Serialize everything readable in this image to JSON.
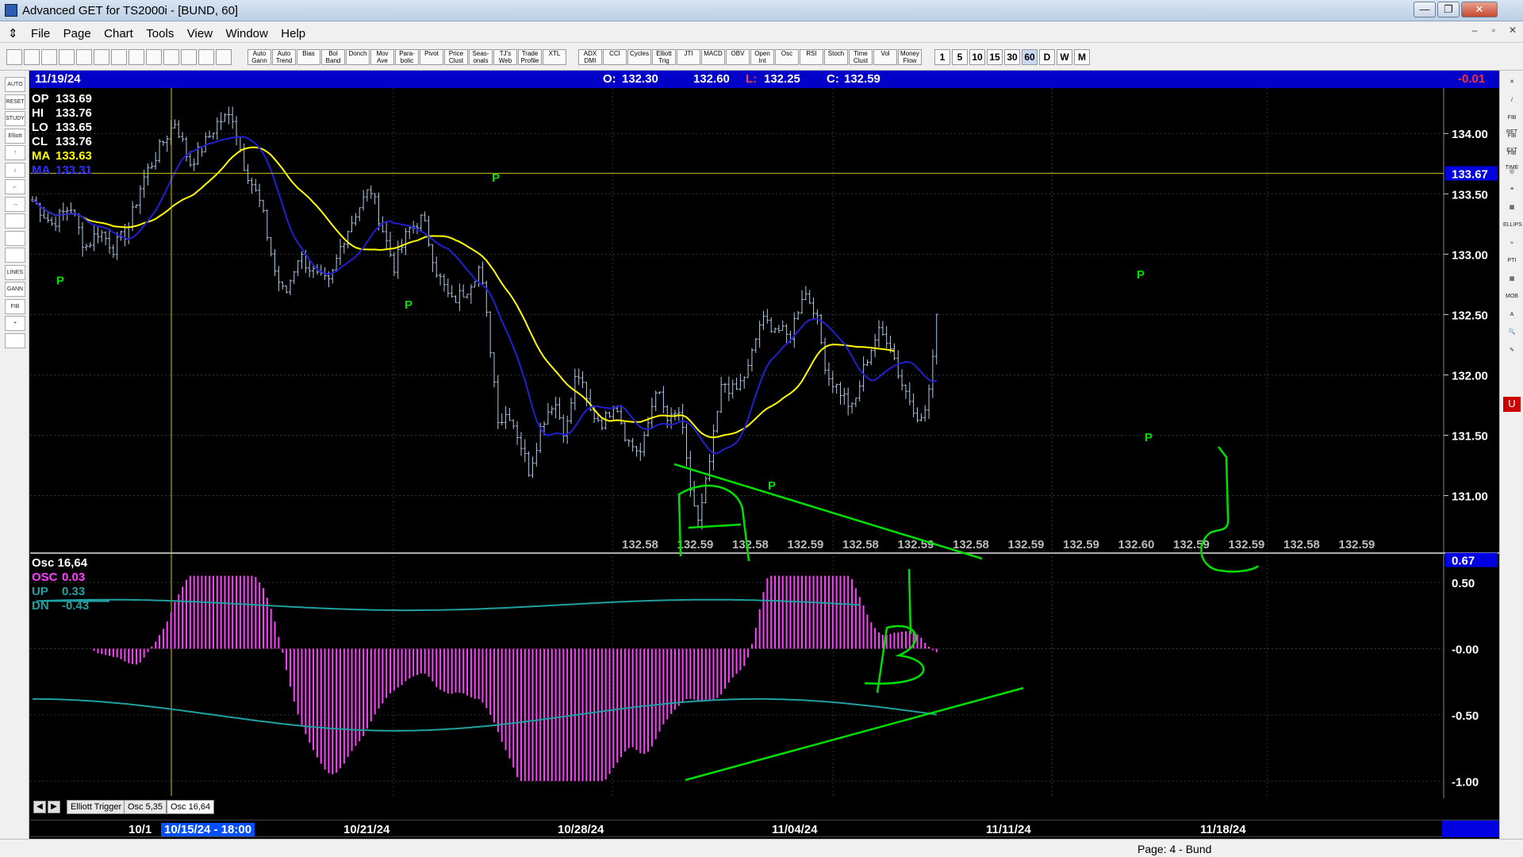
{
  "window": {
    "title": "Advanced GET for TS2000i - [BUND, 60]",
    "buttons": [
      "—",
      "❐",
      "✕"
    ]
  },
  "menu": {
    "items": [
      "File",
      "Page",
      "Chart",
      "Tools",
      "View",
      "Window",
      "Help"
    ],
    "mdi_buttons": [
      "–",
      "▫",
      "✕"
    ]
  },
  "toolbar": {
    "study_buttons": [
      "Auto Gann",
      "Auto Trend",
      "Bias",
      "Bol Band",
      "Donch",
      "Mov Ave",
      "Para-bolic",
      "Pivot",
      "Price Clust",
      "Seas-onals",
      "TJ's Web",
      "Trade Profile",
      "XTL",
      "ADX DMI",
      "CCI",
      "Cycles",
      "Elliott Trig",
      "JTI",
      "MACD",
      "OBV",
      "Open Int",
      "Osc",
      "RSI",
      "Stoch",
      "Time Clust",
      "Vol",
      "Money Flow"
    ],
    "timeframes": [
      "1",
      "5",
      "10",
      "15",
      "30",
      "60",
      "D",
      "W",
      "M"
    ],
    "active_timeframe": "60"
  },
  "left_tools": [
    "AUTO",
    "RESET",
    "STUDY",
    "Elliott",
    "↑",
    "↓",
    "←",
    "→",
    "",
    "",
    "",
    "LINES",
    "GANN",
    "FIB",
    "+",
    ""
  ],
  "right_tools": [
    "✕",
    "/",
    "FIB RET",
    "FIB EXT",
    "FIB TIME",
    "◎",
    "≡",
    "▦",
    "ELLIPS",
    "≈",
    "PTI",
    "▦",
    "MOB",
    "A",
    "🔍",
    "✎",
    "",
    "",
    "U"
  ],
  "header": {
    "date": "11/19/24",
    "open_label": "O:",
    "open": "132.30",
    "high": "132.60",
    "low_label": "L:",
    "low": "132.25",
    "close_label": "C:",
    "close": "132.59",
    "change": "-0.01"
  },
  "price_panel": {
    "stats": [
      {
        "label": "OP",
        "value": "133.69",
        "color": "#ffffff"
      },
      {
        "label": "HI",
        "value": "133.76",
        "color": "#ffffff"
      },
      {
        "label": "LO",
        "value": "133.65",
        "color": "#ffffff"
      },
      {
        "label": "CL",
        "value": "133.76",
        "color": "#ffffff"
      },
      {
        "label": "MA",
        "value": "133.63",
        "color": "#ffff00"
      },
      {
        "label": "MA",
        "value": "133.31",
        "color": "#3030ff"
      }
    ],
    "y_ticks": [
      "134.00",
      "133.50",
      "133.00",
      "132.50",
      "132.00",
      "131.50",
      "131.00"
    ],
    "y_range": [
      130.55,
      134.35
    ],
    "cursor_price": "133.67",
    "bottom_values": [
      "132.58",
      "132.59",
      "132.58",
      "132.59",
      "132.58",
      "132.59",
      "132.58",
      "132.59",
      "132.59",
      "132.60",
      "132.59",
      "132.59",
      "132.58",
      "132.59"
    ],
    "pivot_label": "P",
    "handwritten_labels": [
      "A",
      "B",
      "C"
    ]
  },
  "osc_panel": {
    "stats": [
      {
        "label": "Osc 16,64",
        "value": "",
        "color": "#ffffff"
      },
      {
        "label": "OSC",
        "value": "0.03",
        "color": "#ff40ff"
      },
      {
        "label": "UP",
        "value": "0.33",
        "color": "#20a0a0"
      },
      {
        "label": "DN",
        "value": "-0.43",
        "color": "#20a0a0"
      }
    ],
    "y_ticks": [
      "0.50",
      "-0.00",
      "-0.50",
      "-1.00"
    ],
    "y_range": [
      -1.1,
      0.65
    ],
    "cursor_value": "0.67"
  },
  "chart_data": {
    "type": "candlestick",
    "symbol": "BUND",
    "interval": "60",
    "ylim": [
      130.55,
      134.35
    ],
    "series": [
      {
        "name": "MA",
        "color": "#ffff00",
        "value": 133.63
      },
      {
        "name": "MA",
        "color": "#3030ff",
        "value": 133.31
      }
    ],
    "pivot_lows": [
      132.78,
      132.57,
      131.12,
      131.75,
      131.52
    ],
    "pivot_highs": [
      133.55,
      132.78
    ],
    "oscillator": {
      "name": "Osc 16,64",
      "osc": 0.03,
      "up": 0.33,
      "dn": -0.43,
      "ylim": [
        -1.1,
        0.65
      ]
    },
    "x_dates": [
      "10/1",
      "10/15/24 - 18:00",
      "10/21/24",
      "10/28/24",
      "11/04/24",
      "11/11/24",
      "11/18/24"
    ]
  },
  "tabs": [
    "Elliott Trigger",
    "Osc 5,35",
    "Osc 16,64"
  ],
  "active_tab": "Osc 16,64",
  "dates": {
    "first": "10/1",
    "cursor": "10/15/24 - 18:00",
    "labels": [
      "10/21/24",
      "10/28/24",
      "11/04/24",
      "11/11/24",
      "11/18/24"
    ]
  },
  "status": {
    "page": "Page: 4 - Bund"
  },
  "colors": {
    "background": "#000000",
    "candle": "#b0c8e8",
    "ma_fast": "#ffff00",
    "ma_slow": "#2020d0",
    "osc": "#ff40ff",
    "band": "#20a0a0",
    "annotation": "#00e000",
    "header": "#0000c8"
  }
}
